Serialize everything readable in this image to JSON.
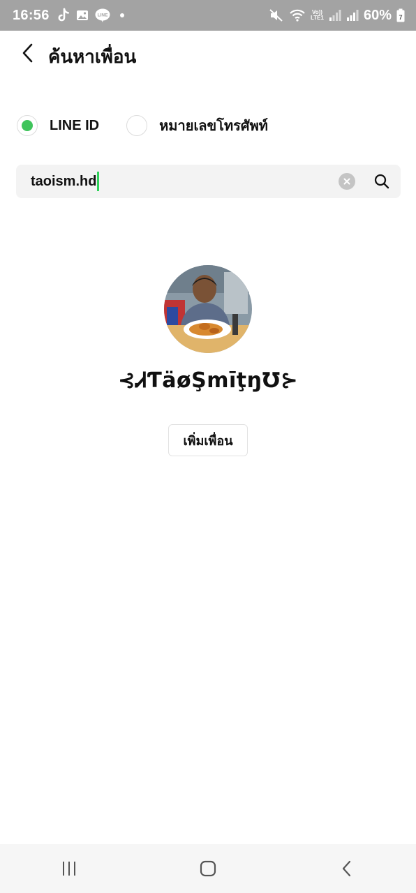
{
  "status_bar": {
    "time": "16:56",
    "left_icons": [
      "tiktok-icon",
      "gallery-icon",
      "line-notification-icon"
    ],
    "line_badge": "LINE",
    "lte_top": "Vo))",
    "lte_bottom": "LTE1",
    "battery_percent": "60%",
    "battery_badge": "7"
  },
  "header": {
    "title": "ค้นหาเพื่อน"
  },
  "search_type": {
    "options": [
      {
        "label": "LINE ID",
        "selected": true
      },
      {
        "label": "หมายเลขโทรศัพท์",
        "selected": false
      }
    ]
  },
  "search": {
    "value": "taoism.hd"
  },
  "result": {
    "name": "⊰ᏗƬäøŞmīţŋ℧⊱",
    "add_button_label": "เพิ่มเพื่อน"
  },
  "colors": {
    "accent_green": "#3fc45b",
    "status_bar_bg": "#a3a3a3"
  }
}
